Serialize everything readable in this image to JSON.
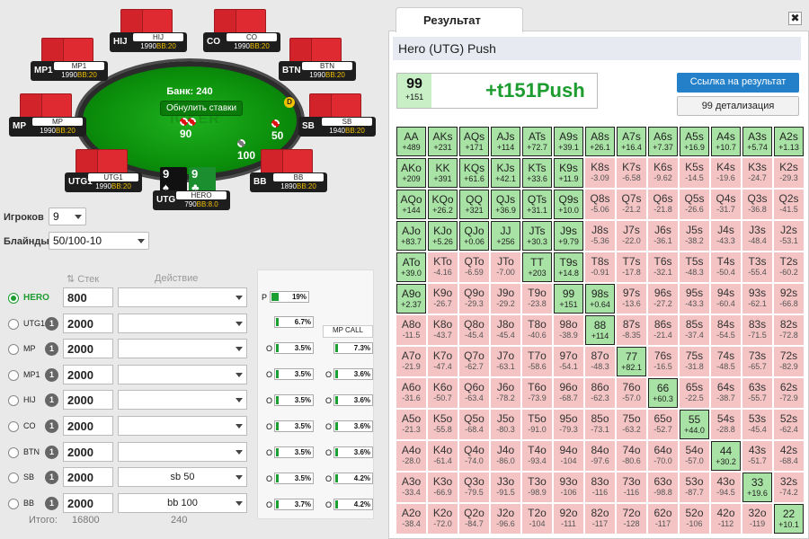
{
  "table": {
    "watermark": "IOKER",
    "bank_label": "Банк: 240",
    "refresh_label": "Обнулить ставки",
    "pot_left": "90",
    "pot_right": "50",
    "pot_bottom": "100",
    "dealer": "D",
    "seats": [
      {
        "pos": "HIJ",
        "name": "HIJ",
        "stack": "1990",
        "bb": "BB:20"
      },
      {
        "pos": "CO",
        "name": "CO",
        "stack": "1990",
        "bb": "BB:20"
      },
      {
        "pos": "MP1",
        "name": "MP1",
        "stack": "1990",
        "bb": "BB:20"
      },
      {
        "pos": "BTN",
        "name": "BTN",
        "stack": "1990",
        "bb": "BB:20"
      },
      {
        "pos": "MP",
        "name": "MP",
        "stack": "1990",
        "bb": "BB:20"
      },
      {
        "pos": "SB",
        "name": "SB",
        "stack": "1940",
        "bb": "BB:20"
      },
      {
        "pos": "UTG1",
        "name": "UTG1",
        "stack": "1990",
        "bb": "BB:20"
      },
      {
        "pos": "BB",
        "name": "BB",
        "stack": "1890",
        "bb": "BB:20"
      }
    ],
    "hero": {
      "pos": "UTG",
      "name": "HERO",
      "stack": "790",
      "bb": "BB:8.0",
      "card1": "9",
      "card2": "9"
    }
  },
  "settings": {
    "players_label": "Игроков",
    "players_value": "9",
    "blinds_label": "Блайнды",
    "blinds_value": "50/100-10"
  },
  "players_table": {
    "stack_header": "Стек",
    "action_header": "Действие",
    "rows": [
      {
        "name": "HERO",
        "badge": "",
        "stack": "800",
        "action": ""
      },
      {
        "name": "UTG1",
        "badge": "1",
        "stack": "2000",
        "action": ""
      },
      {
        "name": "MP",
        "badge": "1",
        "stack": "2000",
        "action": ""
      },
      {
        "name": "MP1",
        "badge": "1",
        "stack": "2000",
        "action": ""
      },
      {
        "name": "HIJ",
        "badge": "1",
        "stack": "2000",
        "action": ""
      },
      {
        "name": "CO",
        "badge": "1",
        "stack": "2000",
        "action": ""
      },
      {
        "name": "BTN",
        "badge": "1",
        "stack": "2000",
        "action": ""
      },
      {
        "name": "SB",
        "badge": "1",
        "stack": "2000",
        "action": "sb 50"
      },
      {
        "name": "BB",
        "badge": "1",
        "stack": "2000",
        "action": "bb 100"
      }
    ],
    "total_label": "Итого:",
    "total_stack": "16800",
    "total_action": "240"
  },
  "tree": {
    "p_node": {
      "letter": "P",
      "pct": "19%",
      "fill": 0.19
    },
    "col1": [
      {
        "letter": "",
        "pct": "6.7%",
        "fill": 0.067
      },
      {
        "letter": "O",
        "pct": "3.5%",
        "fill": 0.035
      },
      {
        "letter": "O",
        "pct": "3.5%",
        "fill": 0.035
      },
      {
        "letter": "O",
        "pct": "3.5%",
        "fill": 0.035
      },
      {
        "letter": "O",
        "pct": "3.5%",
        "fill": 0.035
      },
      {
        "letter": "O",
        "pct": "3.5%",
        "fill": 0.035
      },
      {
        "letter": "O",
        "pct": "3.5%",
        "fill": 0.035
      },
      {
        "letter": "O",
        "pct": "3.7%",
        "fill": 0.037
      }
    ],
    "mp_call": "MP CALL",
    "col2": [
      {
        "letter": "",
        "pct": "7.3%",
        "fill": 0.073
      },
      {
        "letter": "O",
        "pct": "3.6%",
        "fill": 0.036
      },
      {
        "letter": "O",
        "pct": "3.6%",
        "fill": 0.036
      },
      {
        "letter": "O",
        "pct": "3.6%",
        "fill": 0.036
      },
      {
        "letter": "O",
        "pct": "3.6%",
        "fill": 0.036
      },
      {
        "letter": "O",
        "pct": "4.2%",
        "fill": 0.042
      },
      {
        "letter": "O",
        "pct": "4.2%",
        "fill": 0.042
      }
    ]
  },
  "result": {
    "tab": "Результат",
    "close": "✖",
    "scenario": "Hero (UTG) Push",
    "hand": "99",
    "hand_ev": "+151",
    "main": "+t151Push",
    "link_button": "Ссылка на результат",
    "detail_button": "99 детализация"
  },
  "grid": [
    [
      [
        "AA",
        "+489",
        1
      ],
      [
        "AKs",
        "+231",
        1
      ],
      [
        "AQs",
        "+171",
        1
      ],
      [
        "AJs",
        "+114",
        1
      ],
      [
        "ATs",
        "+72.7",
        1
      ],
      [
        "A9s",
        "+39.1",
        1
      ],
      [
        "A8s",
        "+26.1",
        1
      ],
      [
        "A7s",
        "+16.4",
        1
      ],
      [
        "A6s",
        "+7.37",
        1
      ],
      [
        "A5s",
        "+16.9",
        1
      ],
      [
        "A4s",
        "+10.7",
        1
      ],
      [
        "A3s",
        "+5.74",
        1
      ],
      [
        "A2s",
        "+1.13",
        1
      ]
    ],
    [
      [
        "AKo",
        "+209",
        1
      ],
      [
        "KK",
        "+391",
        1
      ],
      [
        "KQs",
        "+61.6",
        1
      ],
      [
        "KJs",
        "+42.1",
        1
      ],
      [
        "KTs",
        "+33.6",
        1
      ],
      [
        "K9s",
        "+11.9",
        1
      ],
      [
        "K8s",
        "-3.09",
        0
      ],
      [
        "K7s",
        "-6.58",
        0
      ],
      [
        "K6s",
        "-9.62",
        0
      ],
      [
        "K5s",
        "-14.5",
        0
      ],
      [
        "K4s",
        "-19.6",
        0
      ],
      [
        "K3s",
        "-24.7",
        0
      ],
      [
        "K2s",
        "-29.3",
        0
      ]
    ],
    [
      [
        "AQo",
        "+144",
        1
      ],
      [
        "KQo",
        "+26.2",
        1
      ],
      [
        "QQ",
        "+321",
        1
      ],
      [
        "QJs",
        "+36.9",
        1
      ],
      [
        "QTs",
        "+31.1",
        1
      ],
      [
        "Q9s",
        "+10.0",
        1
      ],
      [
        "Q8s",
        "-5.06",
        0
      ],
      [
        "Q7s",
        "-21.2",
        0
      ],
      [
        "Q6s",
        "-21.8",
        0
      ],
      [
        "Q5s",
        "-26.6",
        0
      ],
      [
        "Q4s",
        "-31.7",
        0
      ],
      [
        "Q3s",
        "-36.8",
        0
      ],
      [
        "Q2s",
        "-41.5",
        0
      ]
    ],
    [
      [
        "AJo",
        "+83.7",
        1
      ],
      [
        "KJo",
        "+5.26",
        1
      ],
      [
        "QJo",
        "+0.06",
        1
      ],
      [
        "JJ",
        "+256",
        1
      ],
      [
        "JTs",
        "+30.3",
        1
      ],
      [
        "J9s",
        "+9.79",
        1
      ],
      [
        "J8s",
        "-5.36",
        0
      ],
      [
        "J7s",
        "-22.0",
        0
      ],
      [
        "J6s",
        "-36.1",
        0
      ],
      [
        "J5s",
        "-38.2",
        0
      ],
      [
        "J4s",
        "-43.3",
        0
      ],
      [
        "J3s",
        "-48.4",
        0
      ],
      [
        "J2s",
        "-53.1",
        0
      ]
    ],
    [
      [
        "ATo",
        "+39.0",
        1
      ],
      [
        "KTo",
        "-4.16",
        0
      ],
      [
        "QTo",
        "-6.59",
        0
      ],
      [
        "JTo",
        "-7.00",
        0
      ],
      [
        "TT",
        "+203",
        1
      ],
      [
        "T9s",
        "+14.8",
        1
      ],
      [
        "T8s",
        "-0.91",
        0
      ],
      [
        "T7s",
        "-17.8",
        0
      ],
      [
        "T6s",
        "-32.1",
        0
      ],
      [
        "T5s",
        "-48.3",
        0
      ],
      [
        "T4s",
        "-50.4",
        0
      ],
      [
        "T3s",
        "-55.4",
        0
      ],
      [
        "T2s",
        "-60.2",
        0
      ]
    ],
    [
      [
        "A9o",
        "+2.37",
        1
      ],
      [
        "K9o",
        "-26.7",
        0
      ],
      [
        "Q9o",
        "-29.3",
        0
      ],
      [
        "J9o",
        "-29.2",
        0
      ],
      [
        "T9o",
        "-23.8",
        0
      ],
      [
        "99",
        "+151",
        1
      ],
      [
        "98s",
        "+0.64",
        1
      ],
      [
        "97s",
        "-13.6",
        0
      ],
      [
        "96s",
        "-27.2",
        0
      ],
      [
        "95s",
        "-43.3",
        0
      ],
      [
        "94s",
        "-60.4",
        0
      ],
      [
        "93s",
        "-62.1",
        0
      ],
      [
        "92s",
        "-66.8",
        0
      ]
    ],
    [
      [
        "A8o",
        "-11.5",
        0
      ],
      [
        "K8o",
        "-43.7",
        0
      ],
      [
        "Q8o",
        "-45.4",
        0
      ],
      [
        "J8o",
        "-45.4",
        0
      ],
      [
        "T8o",
        "-40.6",
        0
      ],
      [
        "98o",
        "-38.9",
        0
      ],
      [
        "88",
        "+114",
        1
      ],
      [
        "87s",
        "-8.35",
        0
      ],
      [
        "86s",
        "-21.4",
        0
      ],
      [
        "85s",
        "-37.4",
        0
      ],
      [
        "84s",
        "-54.5",
        0
      ],
      [
        "83s",
        "-71.5",
        0
      ],
      [
        "82s",
        "-72.8",
        0
      ]
    ],
    [
      [
        "A7o",
        "-21.9",
        0
      ],
      [
        "K7o",
        "-47.4",
        0
      ],
      [
        "Q7o",
        "-62.7",
        0
      ],
      [
        "J7o",
        "-63.1",
        0
      ],
      [
        "T7o",
        "-58.6",
        0
      ],
      [
        "97o",
        "-54.1",
        0
      ],
      [
        "87o",
        "-48.3",
        0
      ],
      [
        "77",
        "+82.1",
        1
      ],
      [
        "76s",
        "-16.5",
        0
      ],
      [
        "75s",
        "-31.8",
        0
      ],
      [
        "74s",
        "-48.5",
        0
      ],
      [
        "73s",
        "-65.7",
        0
      ],
      [
        "72s",
        "-82.9",
        0
      ]
    ],
    [
      [
        "A6o",
        "-31.6",
        0
      ],
      [
        "K6o",
        "-50.7",
        0
      ],
      [
        "Q6o",
        "-63.4",
        0
      ],
      [
        "J6o",
        "-78.2",
        0
      ],
      [
        "T6o",
        "-73.9",
        0
      ],
      [
        "96o",
        "-68.7",
        0
      ],
      [
        "86o",
        "-62.3",
        0
      ],
      [
        "76o",
        "-57.0",
        0
      ],
      [
        "66",
        "+60.3",
        1
      ],
      [
        "65s",
        "-22.5",
        0
      ],
      [
        "64s",
        "-38.7",
        0
      ],
      [
        "63s",
        "-55.7",
        0
      ],
      [
        "62s",
        "-72.9",
        0
      ]
    ],
    [
      [
        "A5o",
        "-21.3",
        0
      ],
      [
        "K5o",
        "-55.8",
        0
      ],
      [
        "Q5o",
        "-68.4",
        0
      ],
      [
        "J5o",
        "-80.3",
        0
      ],
      [
        "T5o",
        "-91.0",
        0
      ],
      [
        "95o",
        "-79.3",
        0
      ],
      [
        "85o",
        "-73.1",
        0
      ],
      [
        "75o",
        "-63.2",
        0
      ],
      [
        "65o",
        "-52.7",
        0
      ],
      [
        "55",
        "+44.0",
        1
      ],
      [
        "54s",
        "-28.8",
        0
      ],
      [
        "53s",
        "-45.4",
        0
      ],
      [
        "52s",
        "-62.4",
        0
      ]
    ],
    [
      [
        "A4o",
        "-28.0",
        0
      ],
      [
        "K4o",
        "-61.4",
        0
      ],
      [
        "Q4o",
        "-74.0",
        0
      ],
      [
        "J4o",
        "-86.0",
        0
      ],
      [
        "T4o",
        "-93.4",
        0
      ],
      [
        "94o",
        "-104",
        0
      ],
      [
        "84o",
        "-97.6",
        0
      ],
      [
        "74o",
        "-80.6",
        0
      ],
      [
        "64o",
        "-70.0",
        0
      ],
      [
        "54o",
        "-57.0",
        0
      ],
      [
        "44",
        "+30.2",
        1
      ],
      [
        "43s",
        "-51.7",
        0
      ],
      [
        "42s",
        "-68.4",
        0
      ]
    ],
    [
      [
        "A3o",
        "-33.4",
        0
      ],
      [
        "K3o",
        "-66.9",
        0
      ],
      [
        "Q3o",
        "-79.5",
        0
      ],
      [
        "J3o",
        "-91.5",
        0
      ],
      [
        "T3o",
        "-98.9",
        0
      ],
      [
        "93o",
        "-106",
        0
      ],
      [
        "83o",
        "-116",
        0
      ],
      [
        "73o",
        "-116",
        0
      ],
      [
        "63o",
        "-98.8",
        0
      ],
      [
        "53o",
        "-87.7",
        0
      ],
      [
        "43o",
        "-94.5",
        0
      ],
      [
        "33",
        "+19.6",
        1
      ],
      [
        "32s",
        "-74.2",
        0
      ]
    ],
    [
      [
        "A2o",
        "-38.4",
        0
      ],
      [
        "K2o",
        "-72.0",
        0
      ],
      [
        "Q2o",
        "-84.7",
        0
      ],
      [
        "J2o",
        "-96.6",
        0
      ],
      [
        "T2o",
        "-104",
        0
      ],
      [
        "92o",
        "-111",
        0
      ],
      [
        "82o",
        "-117",
        0
      ],
      [
        "72o",
        "-128",
        0
      ],
      [
        "62o",
        "-117",
        0
      ],
      [
        "52o",
        "-106",
        0
      ],
      [
        "42o",
        "-112",
        0
      ],
      [
        "32o",
        "-119",
        0
      ],
      [
        "22",
        "+10.1",
        1
      ]
    ]
  ]
}
